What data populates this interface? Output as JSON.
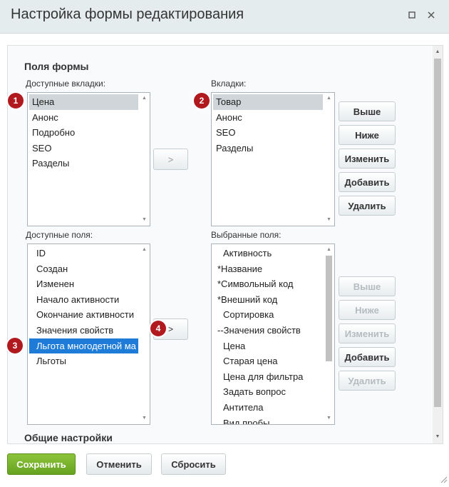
{
  "window": {
    "title": "Настройка формы редактирования",
    "maximize_icon": "square-icon",
    "close_icon": "close-icon"
  },
  "form_fields": {
    "title": "Поля формы",
    "available_tabs_label": "Доступные вкладки:",
    "available_tabs": [
      "Цена",
      "Анонс",
      "Подробно",
      "SEO",
      "Разделы"
    ],
    "tabs_label": "Вкладки:",
    "tabs": [
      "Товар",
      "Анонс",
      "SEO",
      "Разделы"
    ],
    "tabs_move_button": ">",
    "tab_buttons": {
      "up": "Выше",
      "down": "Ниже",
      "edit": "Изменить",
      "add": "Добавить",
      "delete": "Удалить"
    },
    "available_fields_label": "Доступные поля:",
    "available_fields": [
      "ID",
      "Создан",
      "Изменен",
      "Начало активности",
      "Окончание активности",
      "Значения свойств",
      "Льгота многодетной ма",
      "Льготы"
    ],
    "selected_fields_label": "Выбранные поля:",
    "selected_fields": [
      "Активность",
      "*Название",
      "*Символьный код",
      "*Внешний код",
      "Сортировка",
      "--Значения свойств",
      "Цена",
      "Старая цена",
      "Цена для фильтра",
      "Задать вопрос",
      "Антитела",
      "Вид пробы"
    ],
    "fields_move_button": ">",
    "field_buttons": {
      "up": "Выше",
      "down": "Ниже",
      "edit": "Изменить",
      "add": "Добавить",
      "delete": "Удалить"
    }
  },
  "general_settings": {
    "title": "Общие настройки"
  },
  "badges": [
    "1",
    "2",
    "3",
    "4"
  ],
  "footer": {
    "save": "Сохранить",
    "cancel": "Отменить",
    "reset": "Сбросить"
  },
  "colors": {
    "save_green": "#72ad25",
    "badge_red": "#b0191e",
    "selection_blue": "#1e7cd8",
    "selection_grey": "#cfd5d8"
  }
}
